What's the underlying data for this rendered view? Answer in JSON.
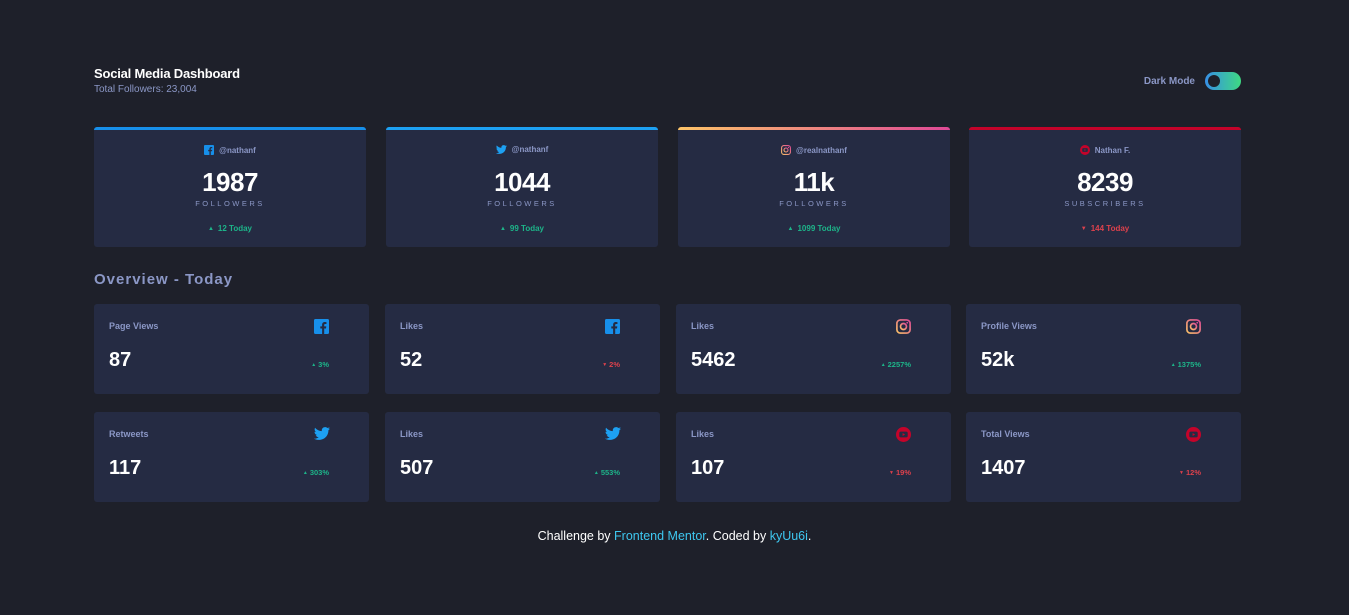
{
  "header": {
    "title": "Social Media Dashboard",
    "subtitle": "Total Followers: 23,004",
    "toggle_label": "Dark Mode"
  },
  "colors": {
    "background": "#1e202a",
    "card": "#252b43",
    "muted_text": "#8b97c6",
    "up": "#1db489",
    "down": "#dc414c",
    "link": "#3ec7f0"
  },
  "cards": [
    {
      "platform": "facebook",
      "icon": "facebook-icon",
      "handle": "@nathanf",
      "count": "1987",
      "unit": "FOLLOWERS",
      "today": "12 Today",
      "trend": "up"
    },
    {
      "platform": "twitter",
      "icon": "twitter-icon",
      "handle": "@nathanf",
      "count": "1044",
      "unit": "FOLLOWERS",
      "today": "99 Today",
      "trend": "up"
    },
    {
      "platform": "instagram",
      "icon": "instagram-icon",
      "handle": "@realnathanf",
      "count": "11k",
      "unit": "FOLLOWERS",
      "today": "1099 Today",
      "trend": "up"
    },
    {
      "platform": "youtube",
      "icon": "youtube-icon",
      "handle": "Nathan F.",
      "count": "8239",
      "unit": "SUBSCRIBERS",
      "today": "144 Today",
      "trend": "down"
    }
  ],
  "overview": {
    "title": "Overview - Today",
    "items": [
      {
        "label": "Page Views",
        "icon": "facebook-icon",
        "value": "87",
        "pct": "3%",
        "trend": "up"
      },
      {
        "label": "Likes",
        "icon": "facebook-icon",
        "value": "52",
        "pct": "2%",
        "trend": "down"
      },
      {
        "label": "Likes",
        "icon": "instagram-icon",
        "value": "5462",
        "pct": "2257%",
        "trend": "up"
      },
      {
        "label": "Profile Views",
        "icon": "instagram-icon",
        "value": "52k",
        "pct": "1375%",
        "trend": "up"
      },
      {
        "label": "Retweets",
        "icon": "twitter-icon",
        "value": "117",
        "pct": "303%",
        "trend": "up"
      },
      {
        "label": "Likes",
        "icon": "twitter-icon",
        "value": "507",
        "pct": "553%",
        "trend": "up"
      },
      {
        "label": "Likes",
        "icon": "youtube-icon",
        "value": "107",
        "pct": "19%",
        "trend": "down"
      },
      {
        "label": "Total Views",
        "icon": "youtube-icon",
        "value": "1407",
        "pct": "12%",
        "trend": "down"
      }
    ]
  },
  "footer": {
    "prefix": "Challenge by ",
    "link1": "Frontend Mentor",
    "middle": ". Coded by ",
    "link2": "kyUu6i",
    "suffix": "."
  }
}
